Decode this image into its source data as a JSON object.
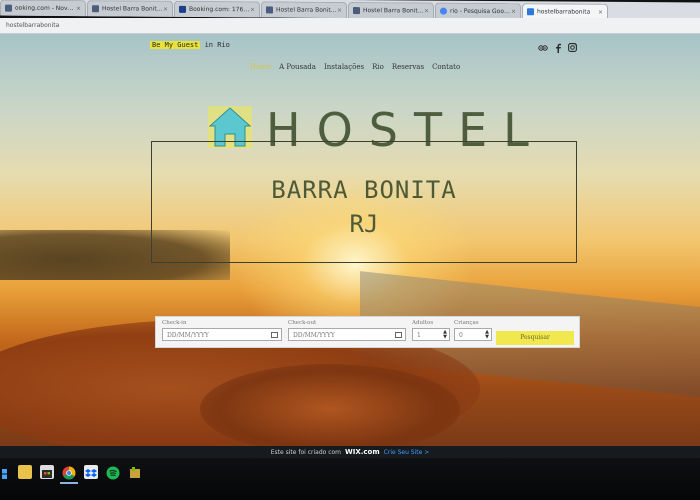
{
  "browser": {
    "tabs": [
      {
        "label": "ooking.com - Nova r..."
      },
      {
        "label": "Hostel Barra Bonita - Ri..."
      },
      {
        "label": "Booking.com: 176 hotéi..."
      },
      {
        "label": "Hostel Barra Bonita - R..."
      },
      {
        "label": "Hostel Barra Bonita - R..."
      },
      {
        "label": "rio - Pesquisa Google"
      },
      {
        "label": "hostelbarrabonita"
      }
    ],
    "address": "hostelbarrabonita"
  },
  "site": {
    "tagline_highlight": "Be My Guest",
    "tagline_rest": " in Rio",
    "nav": [
      "Home",
      "A Pousada",
      "Instalações",
      "Rio",
      "Reservas",
      "Contato"
    ],
    "brand": "HOSTEL",
    "subtitle_line1": "BARRA BONITA",
    "subtitle_line2": "RJ",
    "colors": {
      "accent_yellow": "#f1e74e",
      "brand_olive": "#4e5d3e",
      "house_icon": "#5bc8cf"
    }
  },
  "booking": {
    "checkin_label": "Check-in",
    "checkin_placeholder": "DD/MM/YYYY",
    "checkout_label": "Check-out",
    "checkout_placeholder": "DD/MM/YYYY",
    "adults_label": "Adultos",
    "adults_value": "1",
    "children_label": "Crianças",
    "children_value": "0",
    "search_label": "Pesquisar"
  },
  "wix": {
    "text": "Este site foi criado com",
    "logo": "WIX.com",
    "link": "Crie Seu Site >"
  },
  "taskbar": {
    "apps": [
      "windows-icon",
      "file-explorer-icon",
      "store-icon",
      "chrome-icon",
      "dropbox-icon",
      "spotify-icon",
      "app-icon"
    ]
  }
}
